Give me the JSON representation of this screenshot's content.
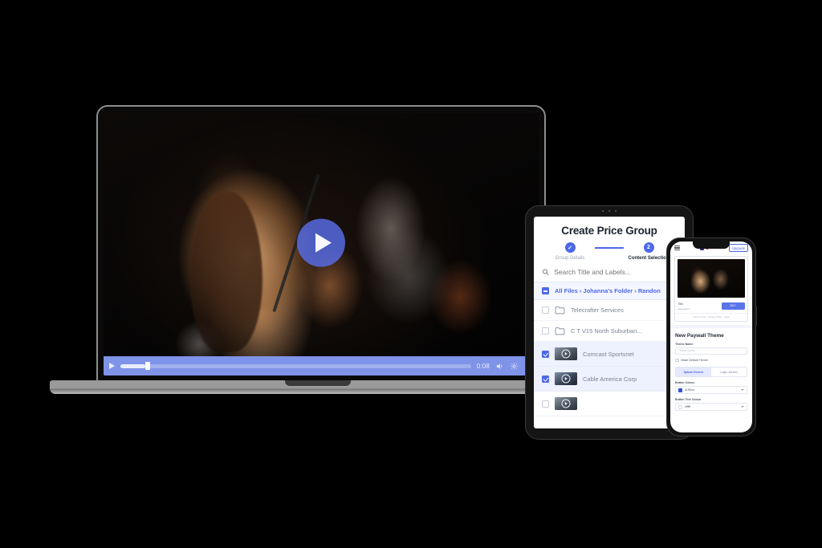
{
  "scene": {
    "background": "#000000",
    "accent": "#4d68e8",
    "devices": [
      "laptop",
      "tablet",
      "phone"
    ]
  },
  "laptop": {
    "device_name": "laptop",
    "player": {
      "play_overlay_icon": "play-circle-icon",
      "play_icon": "play-icon",
      "time_elapsed": "0:08",
      "progress_percent": 7,
      "volume_icon": "volume-icon",
      "settings_icon": "settings-gear-icon",
      "fullscreen_icon": "fullscreen-icon",
      "artwork_alt": "Live concert singer with microphone and guitarist"
    }
  },
  "tablet": {
    "device_name": "tablet",
    "title": "Create Price Group",
    "steps": [
      {
        "label": "Group Details",
        "state": "complete",
        "marker": "✓"
      },
      {
        "label": "Content Selection",
        "state": "active",
        "marker": "2"
      }
    ],
    "search": {
      "placeholder": "Search Title and Labels...",
      "value": "",
      "icon": "search-icon"
    },
    "breadcrumb": {
      "text": "All Files › Johanna's Folder › Randon",
      "checkbox_state": "indeterminate"
    },
    "rows": [
      {
        "name": "Telecrafter Services",
        "type": "folder",
        "checked": false,
        "icon": "folder-icon"
      },
      {
        "name": "C T V15 North Suburban...",
        "type": "folder",
        "checked": false,
        "icon": "folder-icon"
      },
      {
        "name": "Comcast Sportsnet",
        "type": "video",
        "checked": true,
        "icon": "video-thumbnail"
      },
      {
        "name": "Cable America Corp",
        "type": "video",
        "checked": true,
        "icon": "video-thumbnail"
      }
    ]
  },
  "phone": {
    "device_name": "phone",
    "topbar": {
      "menu_icon": "hamburger-menu-icon",
      "logo_icon": "brand-logo-icon",
      "upgrade_label": "Upgrade"
    },
    "preview": {
      "title": "Title",
      "description": "Description",
      "buy_label": "BUY",
      "footer": "Terms of Use · Privacy Policy · Legal"
    },
    "form": {
      "heading": "New Paywall Theme",
      "theme_name_label": "Theme Name",
      "theme_name_placeholder": "Theme Name",
      "theme_name_value": "",
      "default_checkbox_label": "Make Default Theme",
      "default_checked": false,
      "tabs": [
        {
          "label": "Splash Screen",
          "active": true
        },
        {
          "label": "Login Screen",
          "active": false
        }
      ],
      "button_colour_label": "Button Colour",
      "button_colour_value": "#1f50cd",
      "button_colour_swatch": "#2f4fdb",
      "button_text_colour_label": "Button Text Colour",
      "button_text_colour_value": "#ffffff",
      "button_text_colour_swatch": "#ffffff",
      "dropdown_icon": "chevron-down-icon"
    }
  }
}
